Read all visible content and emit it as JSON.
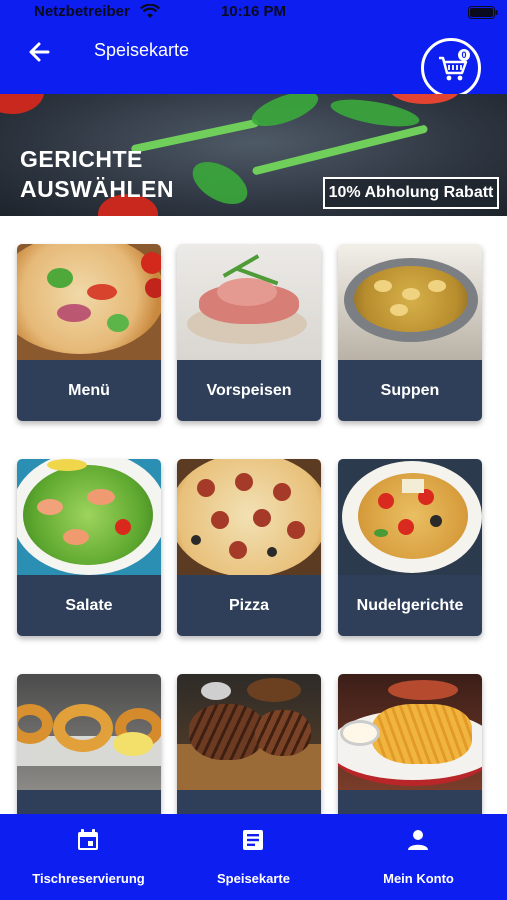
{
  "status_bar": {
    "carrier": "Netzbetreiber",
    "time": "10:16 PM"
  },
  "app_bar": {
    "title": "Speisekarte",
    "cart_count": "0"
  },
  "hero": {
    "heading_line1": "GERICHTE",
    "heading_line2": "AUSWÄHLEN",
    "discount_badge": "10% Abholung Rabatt"
  },
  "categories": [
    {
      "label": "Menü",
      "icon": "pizza-photo"
    },
    {
      "label": "Vorspeisen",
      "icon": "ham-bruschetta-photo"
    },
    {
      "label": "Suppen",
      "icon": "tortellini-soup-photo"
    },
    {
      "label": "Salate",
      "icon": "shrimp-salad-photo"
    },
    {
      "label": "Pizza",
      "icon": "salami-pizza-photo"
    },
    {
      "label": "Nudelgerichte",
      "icon": "spaghetti-photo"
    },
    {
      "label": "",
      "icon": "onion-rings-photo"
    },
    {
      "label": "",
      "icon": "steak-photo"
    },
    {
      "label": "",
      "icon": "fries-photo"
    }
  ],
  "tab_bar": {
    "items": [
      {
        "label": "Tischreservierung",
        "icon": "calendar-icon"
      },
      {
        "label": "Speisekarte",
        "icon": "document-icon"
      },
      {
        "label": "Mein Konto",
        "icon": "person-icon"
      }
    ]
  },
  "colors": {
    "primary": "#0d1ef0",
    "card_label_bg": "#2f3f5a"
  }
}
